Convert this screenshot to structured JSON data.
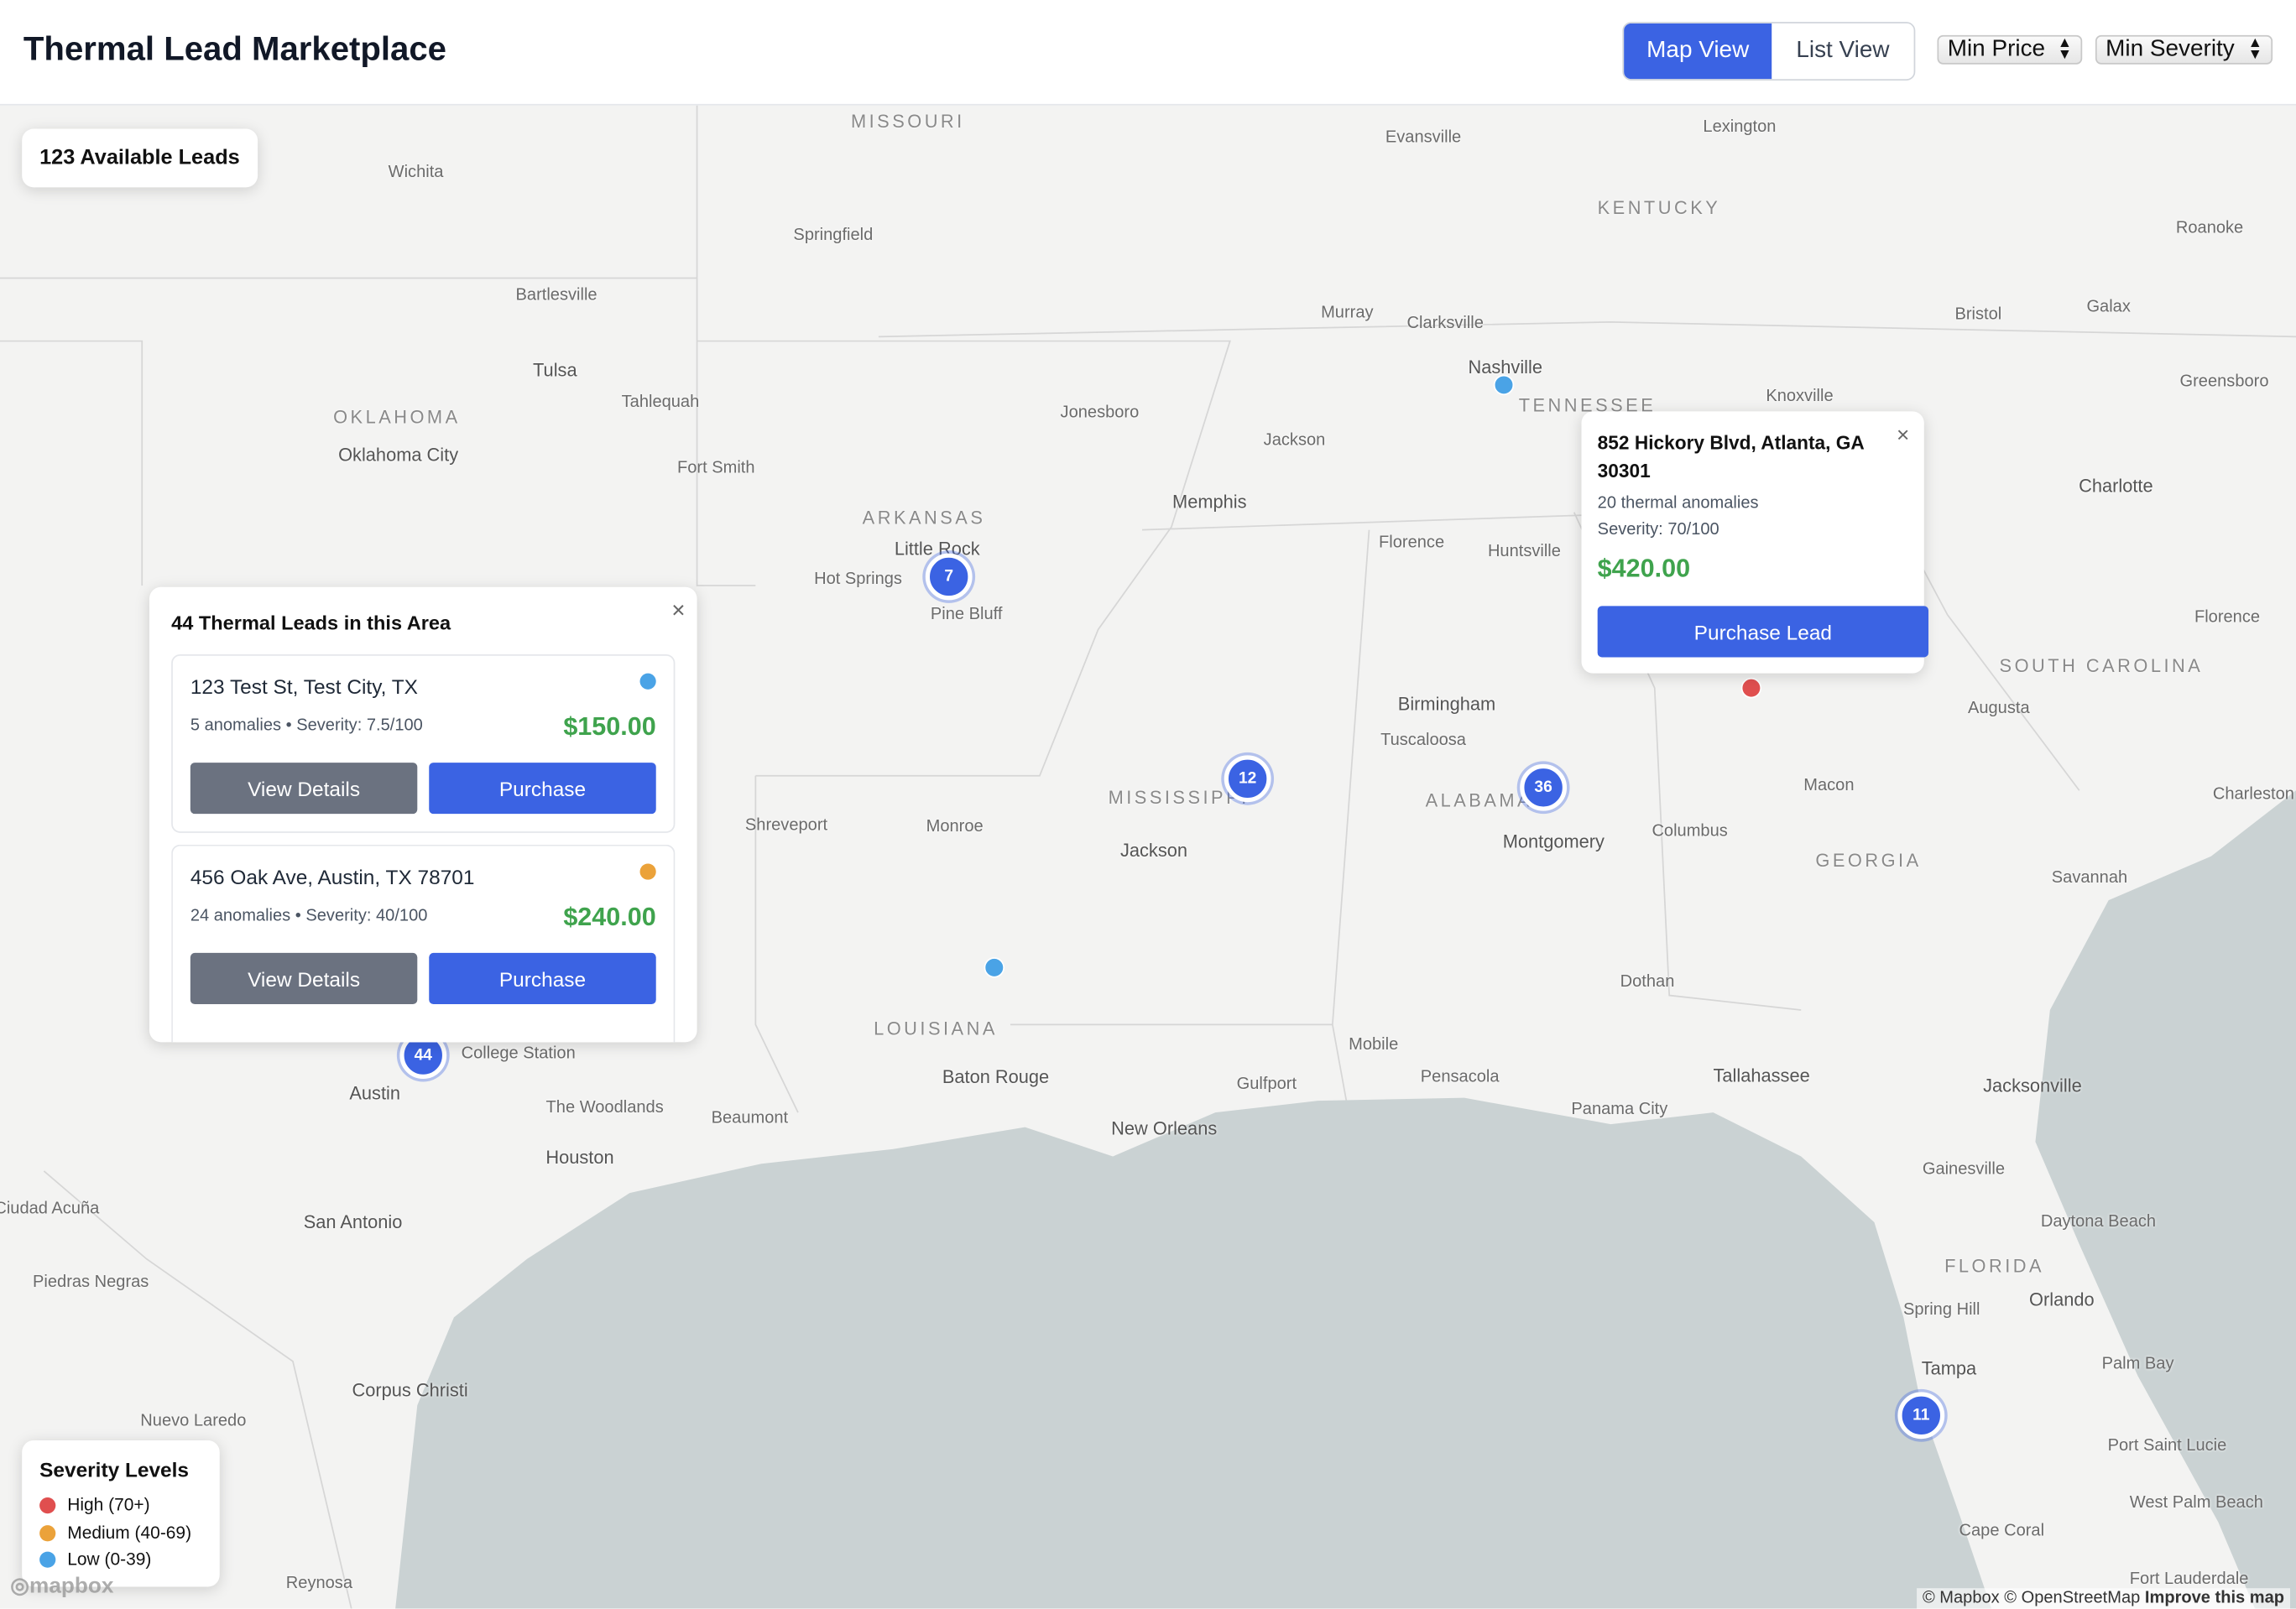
{
  "header": {
    "title": "Thermal Lead Marketplace",
    "view_toggle": {
      "map": "Map View",
      "list": "List View",
      "active": "map"
    },
    "filters": {
      "min_price": "Min Price",
      "min_severity": "Min Severity"
    }
  },
  "map": {
    "available_leads": "123 Available Leads",
    "labels": [
      {
        "name": "MISSOURI",
        "kind": "state"
      },
      {
        "name": "Evansville",
        "kind": "town"
      },
      {
        "name": "Lexington",
        "kind": "town"
      },
      {
        "name": "Wichita",
        "kind": "town"
      },
      {
        "name": "KENTUCKY",
        "kind": "state"
      },
      {
        "name": "Springfield",
        "kind": "town"
      },
      {
        "name": "Roanoke",
        "kind": "town"
      },
      {
        "name": "Bartlesville",
        "kind": "town"
      },
      {
        "name": "Murray",
        "kind": "town"
      },
      {
        "name": "Clarksville",
        "kind": "town"
      },
      {
        "name": "Bristol",
        "kind": "town"
      },
      {
        "name": "Galax",
        "kind": "town"
      },
      {
        "name": "Tulsa",
        "kind": "city"
      },
      {
        "name": "Nashville",
        "kind": "city"
      },
      {
        "name": "Greensboro",
        "kind": "town"
      },
      {
        "name": "TENNESSEE",
        "kind": "state"
      },
      {
        "name": "Knoxville",
        "kind": "town"
      },
      {
        "name": "OKLAHOMA",
        "kind": "state"
      },
      {
        "name": "Tahlequah",
        "kind": "town"
      },
      {
        "name": "Jonesboro",
        "kind": "town"
      },
      {
        "name": "Oklahoma City",
        "kind": "city"
      },
      {
        "name": "Jackson",
        "kind": "town"
      },
      {
        "name": "Fort Smith",
        "kind": "town"
      },
      {
        "name": "Charlotte",
        "kind": "city"
      },
      {
        "name": "Memphis",
        "kind": "city"
      },
      {
        "name": "ARKANSAS",
        "kind": "state"
      },
      {
        "name": "Little Rock",
        "kind": "city"
      },
      {
        "name": "Florence",
        "kind": "town"
      },
      {
        "name": "Huntsville",
        "kind": "town"
      },
      {
        "name": "Hot Springs",
        "kind": "town"
      },
      {
        "name": "Pine Bluff",
        "kind": "town"
      },
      {
        "name": "Florence",
        "kind": "town"
      },
      {
        "name": "SOUTH CAROLINA",
        "kind": "state"
      },
      {
        "name": "Birmingham",
        "kind": "city"
      },
      {
        "name": "Augusta",
        "kind": "town"
      },
      {
        "name": "Tuscaloosa",
        "kind": "town"
      },
      {
        "name": "Macon",
        "kind": "town"
      },
      {
        "name": "MISSISSIPPI",
        "kind": "state"
      },
      {
        "name": "ALABAMA",
        "kind": "state"
      },
      {
        "name": "Charleston",
        "kind": "town"
      },
      {
        "name": "Shreveport",
        "kind": "town"
      },
      {
        "name": "Monroe",
        "kind": "town"
      },
      {
        "name": "Columbus",
        "kind": "town"
      },
      {
        "name": "Montgomery",
        "kind": "city"
      },
      {
        "name": "Jackson",
        "kind": "city"
      },
      {
        "name": "GEORGIA",
        "kind": "state"
      },
      {
        "name": "Savannah",
        "kind": "town"
      },
      {
        "name": "Dothan",
        "kind": "town"
      },
      {
        "name": "LOUISIANA",
        "kind": "state"
      },
      {
        "name": "Mobile",
        "kind": "town"
      },
      {
        "name": "College Station",
        "kind": "town"
      },
      {
        "name": "Baton Rouge",
        "kind": "city"
      },
      {
        "name": "Pensacola",
        "kind": "town"
      },
      {
        "name": "Tallahassee",
        "kind": "city"
      },
      {
        "name": "Jacksonville",
        "kind": "city"
      },
      {
        "name": "Gulfport",
        "kind": "town"
      },
      {
        "name": "Austin",
        "kind": "city"
      },
      {
        "name": "The Woodlands",
        "kind": "town"
      },
      {
        "name": "Beaumont",
        "kind": "town"
      },
      {
        "name": "Panama City",
        "kind": "town"
      },
      {
        "name": "New Orleans",
        "kind": "city"
      },
      {
        "name": "Houston",
        "kind": "city"
      },
      {
        "name": "Gainesville",
        "kind": "town"
      },
      {
        "name": "Ciudad Acuña",
        "kind": "town"
      },
      {
        "name": "San Antonio",
        "kind": "city"
      },
      {
        "name": "Daytona Beach",
        "kind": "town"
      },
      {
        "name": "FLORIDA",
        "kind": "state"
      },
      {
        "name": "Piedras Negras",
        "kind": "town"
      },
      {
        "name": "Orlando",
        "kind": "city"
      },
      {
        "name": "Spring Hill",
        "kind": "town"
      },
      {
        "name": "Tampa",
        "kind": "city"
      },
      {
        "name": "Palm Bay",
        "kind": "town"
      },
      {
        "name": "Corpus Christi",
        "kind": "city"
      },
      {
        "name": "Nuevo Laredo",
        "kind": "town"
      },
      {
        "name": "Port Saint Lucie",
        "kind": "town"
      },
      {
        "name": "West Palm Beach",
        "kind": "town"
      },
      {
        "name": "Cape Coral",
        "kind": "town"
      },
      {
        "name": "Reynosa",
        "kind": "town"
      },
      {
        "name": "Fort Lauderdale",
        "kind": "town"
      }
    ],
    "clusters": [
      {
        "count": "7"
      },
      {
        "count": "12"
      },
      {
        "count": "36"
      },
      {
        "count": "44"
      },
      {
        "count": "11"
      }
    ],
    "markers": [
      {
        "severity": "low"
      },
      {
        "severity": "low"
      },
      {
        "severity": "high"
      }
    ],
    "attribution": {
      "text": "© Mapbox © OpenStreetMap",
      "link": "Improve this map"
    },
    "logo": "mapbox",
    "water_color": "#cad2d3",
    "land_color": "#f3f3f2"
  },
  "cluster_popup": {
    "title": "44 Thermal Leads in this Area",
    "leads": [
      {
        "address": "123 Test St, Test City, TX",
        "meta": "5 anomalies • Severity: 7.5/100",
        "price": "$150.00",
        "severity": "low",
        "view": "View Details",
        "purchase": "Purchase"
      },
      {
        "address": "456 Oak Ave, Austin, TX 78701",
        "meta": "24 anomalies • Severity: 40/100",
        "price": "$240.00",
        "severity": "medium",
        "view": "View Details",
        "purchase": "Purchase"
      }
    ]
  },
  "lead_popup": {
    "address": "852 Hickory Blvd, Atlanta, GA 30301",
    "anomalies": "20 thermal anomalies",
    "severity": "Severity: 70/100",
    "price": "$420.00",
    "button": "Purchase Lead"
  },
  "legend": {
    "title": "Severity Levels",
    "items": [
      {
        "label": "High (70+)",
        "color": "#e04f4f"
      },
      {
        "label": "Medium (40-69)",
        "color": "#eba23a"
      },
      {
        "label": "Low (0-39)",
        "color": "#4aa3e6"
      }
    ]
  },
  "colors": {
    "accent": "#3b63e3",
    "price": "#3fa34d",
    "high": "#e04f4f",
    "medium": "#eba23a",
    "low": "#4aa3e6"
  }
}
